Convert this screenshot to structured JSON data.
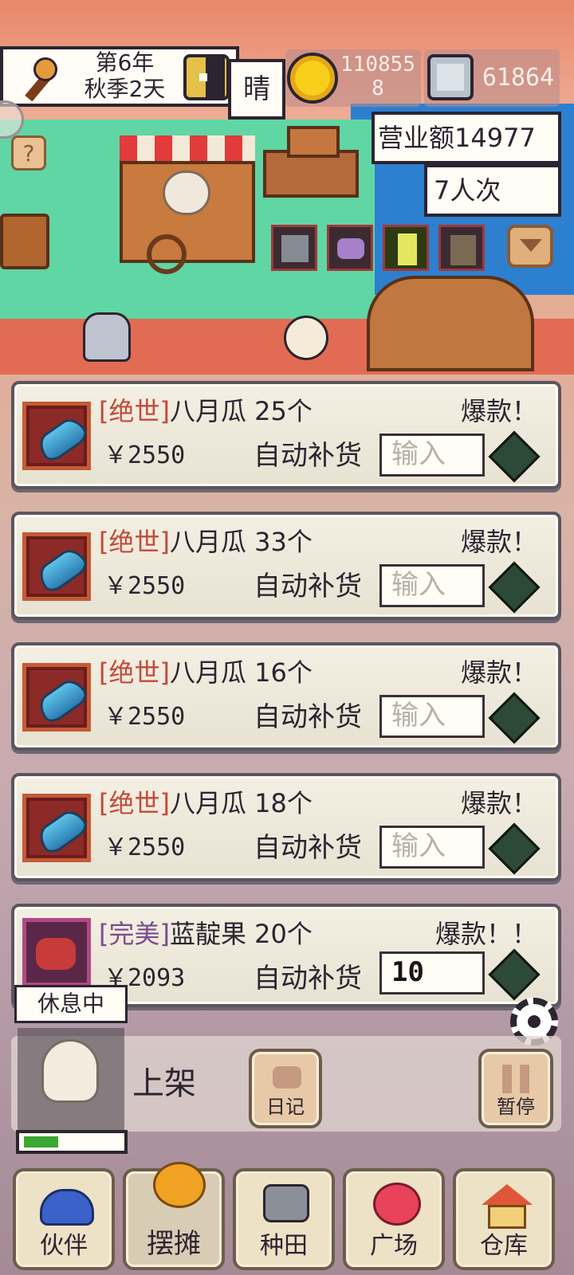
{
  "header": {
    "year_label": "第6年",
    "season_label": "秋季2天",
    "weather": "晴",
    "gold": "110855\n8",
    "silver": "61864",
    "revenue_label": "营业额14977",
    "visitors_label": "7人次"
  },
  "items": [
    {
      "tier": "[绝世]",
      "name": "八月瓜",
      "count": "25个",
      "tag": "爆款！",
      "price": "￥2550",
      "auto_label": "自动补货",
      "input_placeholder": "输入",
      "input_value": ""
    },
    {
      "tier": "[绝世]",
      "name": "八月瓜",
      "count": "33个",
      "tag": "爆款！",
      "price": "￥2550",
      "auto_label": "自动补货",
      "input_placeholder": "输入",
      "input_value": ""
    },
    {
      "tier": "[绝世]",
      "name": "八月瓜",
      "count": "16个",
      "tag": "爆款！",
      "price": "￥2550",
      "auto_label": "自动补货",
      "input_placeholder": "输入",
      "input_value": ""
    },
    {
      "tier": "[绝世]",
      "name": "八月瓜",
      "count": "18个",
      "tag": "爆款！",
      "price": "￥2550",
      "auto_label": "自动补货",
      "input_placeholder": "输入",
      "input_value": ""
    },
    {
      "tier": "[完美]",
      "name": "蓝靛果",
      "count": "20个",
      "tag": "爆款！！",
      "price": "￥2093",
      "auto_label": "自动补货",
      "input_placeholder": "输入",
      "input_value": "10"
    }
  ],
  "status": {
    "rest_label": "休息中",
    "stamina_fraction": 0.35
  },
  "actions": {
    "shelve_label": "上架",
    "diary_label": "日记",
    "pause_label": "暂停"
  },
  "nav": [
    {
      "label": "伙伴",
      "icon": "partner-icon"
    },
    {
      "label": "摆摊",
      "icon": "stall-icon"
    },
    {
      "label": "种田",
      "icon": "farming-icon"
    },
    {
      "label": "广场",
      "icon": "plaza-icon"
    },
    {
      "label": "仓库",
      "icon": "warehouse-icon"
    }
  ],
  "colors": {
    "accent_green": "#2d4a36",
    "tier_red": "#c04b3a",
    "tier_purple": "#7d4b8c"
  }
}
